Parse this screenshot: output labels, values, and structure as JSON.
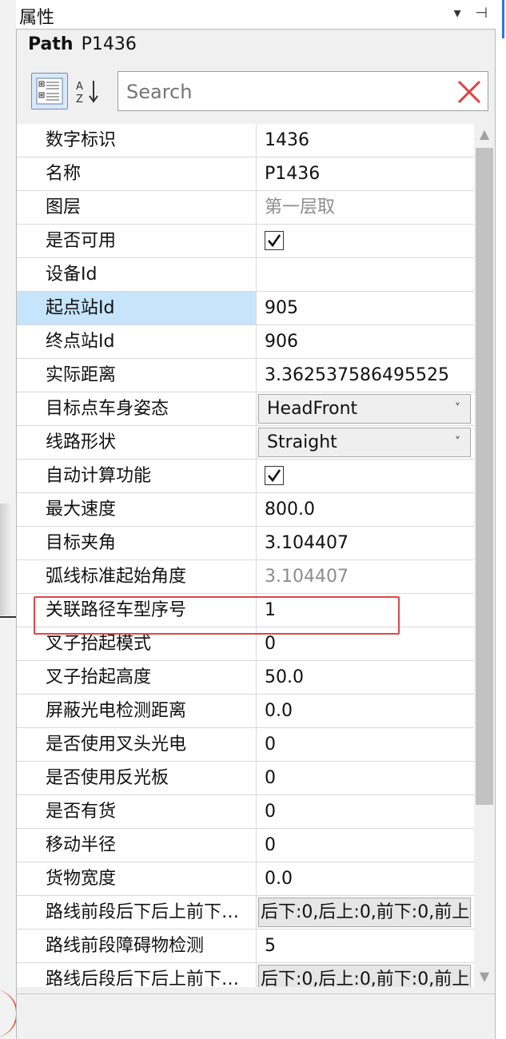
{
  "panel_title": "属性",
  "title_icons": "▾ ⊣",
  "object": {
    "type": "Path",
    "name": "P1436"
  },
  "search": {
    "placeholder": "Search"
  },
  "toolbar": {
    "sort_az_label": "A Z ↓"
  },
  "rows": [
    {
      "label": "数字标识",
      "value": "1436",
      "kind": "text"
    },
    {
      "label": "名称",
      "value": "P1436",
      "kind": "text"
    },
    {
      "label": "图层",
      "value": "第一层取",
      "kind": "text-gray"
    },
    {
      "label": "是否可用",
      "value": "true",
      "kind": "checkbox"
    },
    {
      "label": "设备Id",
      "value": "",
      "kind": "text"
    },
    {
      "label": "起点站Id",
      "value": "905",
      "kind": "text",
      "selected": true
    },
    {
      "label": "终点站Id",
      "value": "906",
      "kind": "text"
    },
    {
      "label": "实际距离",
      "value": "3.362537586495525",
      "kind": "text"
    },
    {
      "label": "目标点车身姿态",
      "value": "HeadFront",
      "kind": "dropdown"
    },
    {
      "label": "线路形状",
      "value": "Straight",
      "kind": "dropdown"
    },
    {
      "label": "自动计算功能",
      "value": "true",
      "kind": "checkbox"
    },
    {
      "label": "最大速度",
      "value": "800.0",
      "kind": "text"
    },
    {
      "label": "目标夹角",
      "value": "3.104407",
      "kind": "text"
    },
    {
      "label": "弧线标准起始角度",
      "value": "3.104407",
      "kind": "text-gray"
    },
    {
      "label": "关联路径车型序号",
      "value": "1",
      "kind": "text"
    },
    {
      "label": "叉子抬起模式",
      "value": "0",
      "kind": "text"
    },
    {
      "label": "叉子抬起高度",
      "value": "50.0",
      "kind": "text"
    },
    {
      "label": "屏蔽光电检测距离",
      "value": "0.0",
      "kind": "text"
    },
    {
      "label": "是否使用叉头光电",
      "value": "0",
      "kind": "text"
    },
    {
      "label": "是否使用反光板",
      "value": "0",
      "kind": "text"
    },
    {
      "label": "是否有货",
      "value": "0",
      "kind": "text"
    },
    {
      "label": "移动半径",
      "value": "0",
      "kind": "text"
    },
    {
      "label": "货物宽度",
      "value": "0.0",
      "kind": "text"
    },
    {
      "label": "路线前段后下后上前下…",
      "value": "后下:0,后上:0,前下:0,前上",
      "kind": "ellipsis"
    },
    {
      "label": "路线前段障碍物检测",
      "value": "5",
      "kind": "text"
    },
    {
      "label": "路线后段后下后上前下…",
      "value": "后下:0,后上:0,前下:0,前上",
      "kind": "ellipsis"
    }
  ],
  "colors": {
    "selected_bg": "#c6e4fa",
    "highlight_border": "#e04646",
    "accent": "#2b79d8"
  }
}
